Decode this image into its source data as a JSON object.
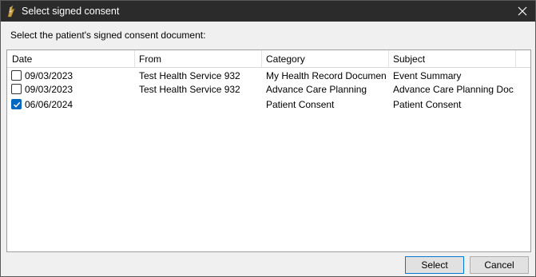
{
  "window": {
    "title": "Select signed consent"
  },
  "instruction": "Select the patient's signed consent document:",
  "table": {
    "columns": [
      "Date",
      "From",
      "Category",
      "Subject"
    ],
    "rows": [
      {
        "checked": false,
        "date": "09/03/2023",
        "from": "Test Health Service 932",
        "category": "My Health Record Document",
        "subject": "Event Summary"
      },
      {
        "checked": false,
        "date": "09/03/2023",
        "from": "Test Health Service 932",
        "category": "Advance Care Planning",
        "subject": "Advance Care Planning Doc..."
      },
      {
        "checked": true,
        "date": "06/06/2024",
        "from": "",
        "category": "Patient Consent",
        "subject": "Patient Consent"
      }
    ]
  },
  "buttons": {
    "select": "Select",
    "cancel": "Cancel"
  },
  "colors": {
    "titlebar": "#2b2b2b",
    "accent": "#0067c0"
  },
  "icons": {
    "app": "app-icon",
    "close": "close-icon",
    "check": "checkmark-icon"
  }
}
